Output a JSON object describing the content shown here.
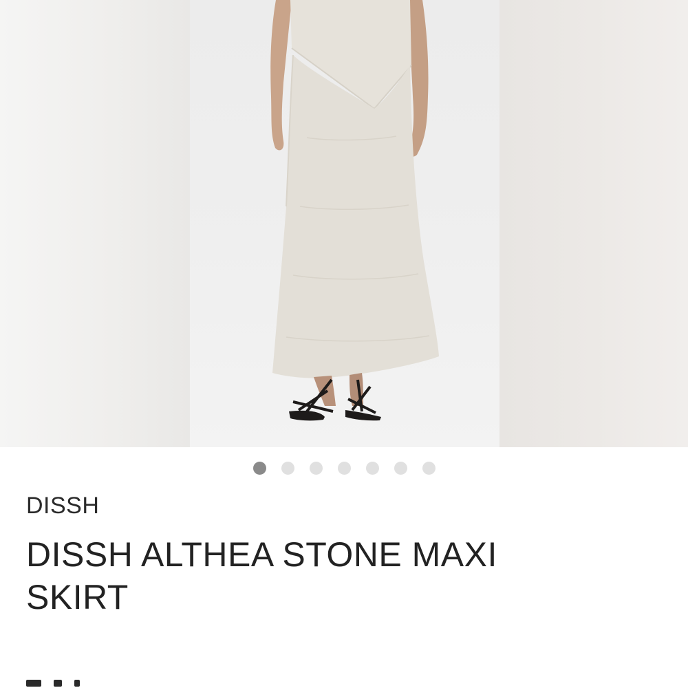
{
  "gallery": {
    "image_alt": "Model wearing stone knit maxi skirt with matching asymmetric top",
    "image_count": 7,
    "active_index": 0
  },
  "product": {
    "brand": "DISSH",
    "title": "DISSH ALTHEA STONE MAXI SKIRT"
  },
  "colors": {
    "skirt": "#e3dfd7",
    "background": "#ffffff",
    "dot_active": "#8a8a8a",
    "dot_inactive": "#e0e0e0"
  }
}
